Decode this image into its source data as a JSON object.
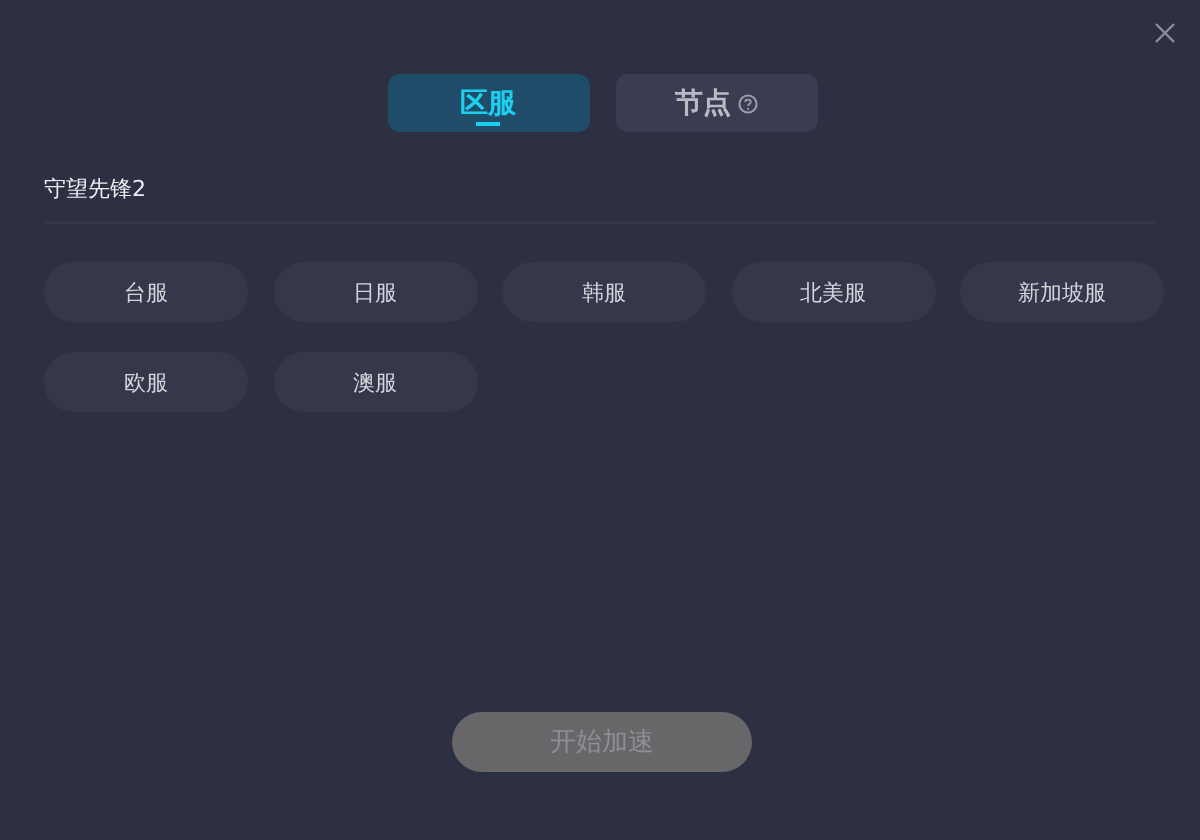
{
  "tabs": [
    {
      "label": "区服",
      "selected": true,
      "help": false
    },
    {
      "label": "节点",
      "selected": false,
      "help": true
    }
  ],
  "game": {
    "title": "守望先锋2"
  },
  "servers": [
    {
      "label": "台服"
    },
    {
      "label": "日服"
    },
    {
      "label": "韩服"
    },
    {
      "label": "北美服"
    },
    {
      "label": "新加坡服"
    },
    {
      "label": "欧服"
    },
    {
      "label": "澳服"
    }
  ],
  "start_button": {
    "label": "开始加速",
    "disabled": true
  }
}
